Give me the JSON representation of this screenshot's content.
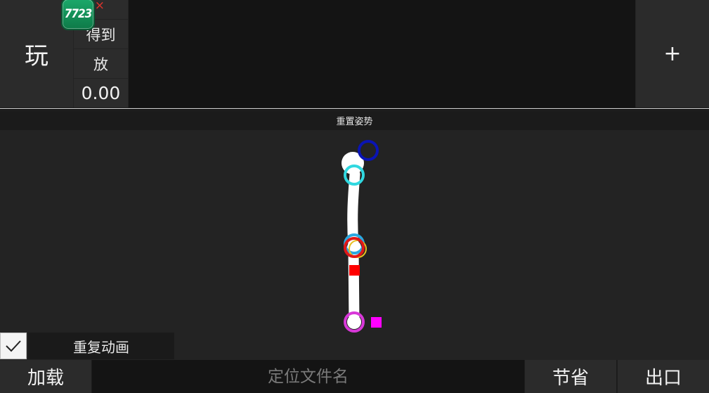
{
  "toolbar": {
    "play_label": "玩",
    "close_icon": "close-icon",
    "close_glyph": "×",
    "get_label": "得到",
    "put_label": "放",
    "time_value": "0.00",
    "add_label": "+"
  },
  "badge": {
    "text": "7723"
  },
  "reset_pose_label": "重置姿势",
  "loop": {
    "checked": true,
    "label": "重复动画",
    "check_icon": "checkmark-icon"
  },
  "bottom": {
    "load_label": "加载",
    "filename_placeholder": "定位文件名",
    "filename_value": "",
    "save_label": "节省",
    "export_label": "出口"
  },
  "colors": {
    "head_handle": "#0a14b4",
    "neck_handle": "#30d8e0",
    "knee_handle_outer": "#e01818",
    "knee_handle_inner": "#2aa8e0",
    "foot_handle": "#d838d8",
    "limb": "#ffffff",
    "knee_marker": "#ff0000",
    "foot_marker": "#ff00ff"
  }
}
